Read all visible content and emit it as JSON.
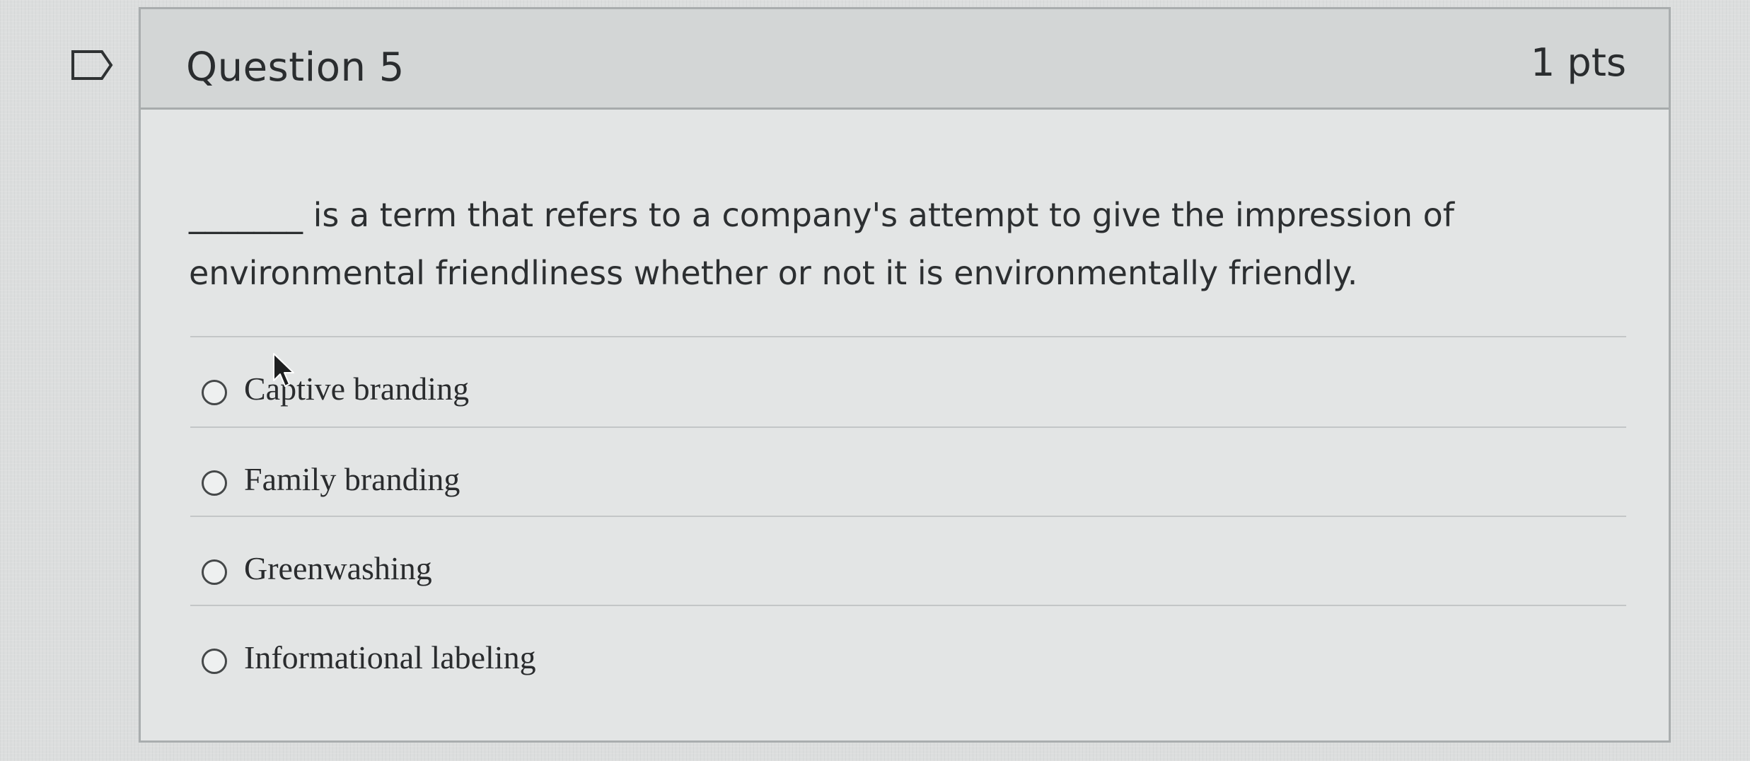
{
  "question": {
    "title": "Question 5",
    "points": "1 pts",
    "text": "_______ is a term that refers to a company's attempt to give the impression of environmental friendliness whether or not it is environmentally friendly."
  },
  "answers": [
    {
      "label": "Captive branding"
    },
    {
      "label": "Family branding"
    },
    {
      "label": "Greenwashing"
    },
    {
      "label": "Informational labeling"
    }
  ],
  "icons": {
    "bookmark": "bookmark-flag-icon",
    "radio": "radio-button-empty-icon",
    "cursor": "mouse-pointer-icon"
  },
  "colors": {
    "border": "#a9adae",
    "text": "#2a2d2f",
    "header_bg": "#d3d6d6"
  }
}
